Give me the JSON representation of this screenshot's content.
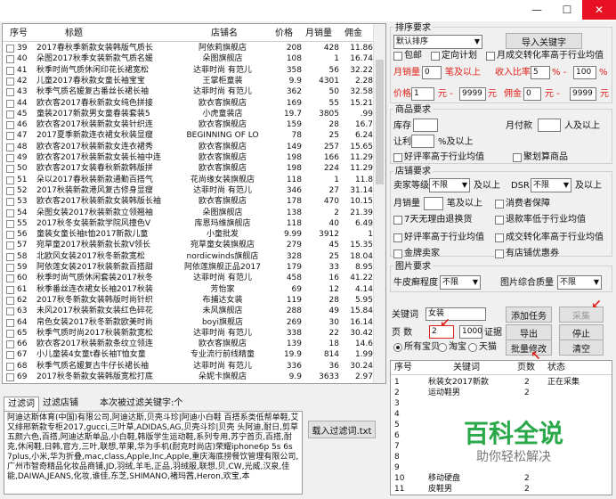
{
  "window": {
    "min": "—",
    "max": "☐",
    "close": "✕"
  },
  "grid": {
    "headers": [
      "序号",
      "标题",
      "店铺名",
      "价格",
      "月销量",
      "佣金"
    ],
    "rows": [
      [
        "39",
        "2017春秋季新款女装韩版气质长",
        "阿依莉旗舰店",
        "208",
        "428",
        "11.86"
      ],
      [
        "40",
        "朵图2017秋季女装新款气质名媛",
        "朵图旗舰店",
        "108",
        "1",
        "16.74"
      ],
      [
        "41",
        "秋季时尚气质休闲印花长裙宽松",
        "达菲时尚 有范儿",
        "358",
        "56",
        "32.22"
      ],
      [
        "42",
        "儿童2017春秋款女童长袖宝宝",
        "王掌柜童装",
        "9.9",
        "4301",
        "2.28"
      ],
      [
        "43",
        "秋季气质名媛复古番丝长裙长袖",
        "达菲时尚 有范儿",
        "362",
        "50",
        "32.58"
      ],
      [
        "44",
        "欧衣客2017春秋新款女纯色拼接",
        "欧衣客旗舰店",
        "169",
        "55",
        "15.21"
      ],
      [
        "45",
        "童装2017新款男女童春装套装5",
        "小虎童装店",
        "19.7",
        "3805",
        ".99"
      ],
      [
        "46",
        "欧衣客2017秋装新款女装针织连",
        "欧衣客旗舰店",
        "159",
        "28",
        "16.7"
      ],
      [
        "47",
        "2017夏季新款连衣裙女秋装显瘦",
        "BEGINNING OF LO",
        "78",
        "25",
        "6.24"
      ],
      [
        "48",
        "欧衣客2017秋装新款女连衣裙秀",
        "欧衣客旗舰店",
        "149",
        "257",
        "15.65"
      ],
      [
        "49",
        "欧衣客2017秋装新款女装长袖中连",
        "欧衣客旗舰店",
        "198",
        "166",
        "11.29"
      ],
      [
        "50",
        "欧衣客2017女装春秋新款韩版拼",
        "欧衣客旗舰店",
        "198",
        "224",
        "11.29"
      ],
      [
        "51",
        "朵以2017春秋装新款通勤百搭气",
        "花尚缘女装旗舰店",
        "118",
        "1",
        "11.8"
      ],
      [
        "52",
        "2017秋装新款港风复古修身显瘦",
        "达菲时尚 有范儿",
        "346",
        "27",
        "31.14"
      ],
      [
        "53",
        "欧衣客2017秋装新款女装韩版长袖",
        "欧衣客旗舰店",
        "178",
        "470",
        "10.15"
      ],
      [
        "54",
        "朵图女装2017秋装新款立领翘袖",
        "朵图旗舰店",
        "138",
        "2",
        "21.39"
      ],
      [
        "55",
        "2017秋冬女装新款学院风撞色V",
        "库恩玛维旗舰店",
        "118",
        "40",
        "6.49"
      ],
      [
        "56",
        "童装女童长袖t恤2017新款儿童",
        "小童批发",
        "9.99",
        "3912",
        "1"
      ],
      [
        "57",
        "宛草童2017秋装新款长款V领长",
        "宛草童女装旗舰店",
        "279",
        "45",
        "15.35"
      ],
      [
        "58",
        "北欧风女装2017秋冬新款宽松",
        "nordicwinds旗舰店",
        "328",
        "25",
        "18.04"
      ],
      [
        "59",
        "阿依莲女装2017秋装新款百搭甜",
        "阿依莲旗舰正品2017",
        "179",
        "33",
        "8.95"
      ],
      [
        "60",
        "秋季时尚气质休闲套装2017秋冬",
        "达菲时尚 有范儿",
        "458",
        "16",
        "41.22"
      ],
      [
        "61",
        "秋季番丝连衣裙女长袖2017秋装",
        "芳怡家",
        "69",
        "12",
        "4.14"
      ],
      [
        "62",
        "2017秋冬新款女装韩版时尚针织",
        "布捕达女装",
        "119",
        "28",
        "5.95"
      ],
      [
        "63",
        "未风2017秋装新款女装红色碎花",
        "未风旗舰店",
        "288",
        "49",
        "15.84"
      ],
      [
        "64",
        "帛色女装2017秋冬新款欧美时尚",
        "boyi旗舰店",
        "269",
        "30",
        "16.14"
      ],
      [
        "65",
        "秋季气质时尚2017秋装新款宽松",
        "达菲时尚 有范儿",
        "338",
        "22",
        "30.42"
      ],
      [
        "66",
        "欧衣客2017秋装新款条纹立领连",
        "欧衣客旗舰店",
        "139",
        "18",
        "14.6"
      ],
      [
        "67",
        "小儿童装4女童t春长袖T恤女童",
        "专业流行前线精童",
        "19.9",
        "814",
        "1.99"
      ],
      [
        "68",
        "秋季气质名媛复古牛仔长裙长袖",
        "达菲时尚 有范儿",
        "336",
        "36",
        "30.24"
      ],
      [
        "69",
        "2017秋冬新款女装韩版宽松打底",
        "朵妮卡旗舰店",
        "9.9",
        "3633",
        "2.97"
      ]
    ]
  },
  "filter": {
    "tab_filter": "过滤词",
    "tab_shop": "过滤店铺",
    "count_label": "本次被过滤关键字:个",
    "text": "阿迪达斯体育(中国)有限公司,阿迪达斯,贝壳斗珍|阿迪小白鞋 百搭系类低帮单鞋,艾又绯邢新款专柜2017,gucci,三叶草,ADIDAS,AG,贝壳斗珍|贝壳 头阿迪,耐日,剪草五颜六色,百搭,阿迪达斯单品,小白鞋,韩版学生运动鞋,系列专用,苏宁首页,百搭,耐克,休闲鞋,日韩,官方,三叶,联想,苹果,华为手机(耐克时尚店)荣耀iphone6p 5s 6s 7plus,小米,华为折叠,mac,class,Apple,Inc,Apple,重庆海底捞餐饮管理有限公司,广州市智奇精品化妆品商铺,JD,羽绒,羊毛,正品,羽绒服,联想,贝,CW,光威,汉泉,佳能,DAIWA,JEANS,化妆,谁佳,东芝,SHIMANO,褚玛茜,Heron,欢宝,本",
    "load_btn": "载入过滤词.txt"
  },
  "sort": {
    "group_title": "排序要求",
    "sort_value": "默认排序",
    "import_btn": "导入关键字",
    "baoyou": "包邮",
    "dingxiang": "定向计划",
    "yuecheng": "月成交转化率高于行业均值",
    "month_sales_label": "月销量",
    "month_sales_min": "0",
    "month_sales_to": "笔及以上",
    "ratio_label": "收入比率",
    "ratio_min": "5",
    "ratio_pct1": "% -",
    "ratio_max": "100",
    "ratio_pct2": "%",
    "price_label": "价格",
    "price_min": "1",
    "yuan1": "元 -",
    "price_max": "9999",
    "yuan2": "元",
    "comm_label": "佣金",
    "comm_min": "0",
    "yuan3": "元 -",
    "comm_max": "9999",
    "yuan4": "元"
  },
  "product": {
    "group_title": "商品要求",
    "stock": "库存",
    "month_pay": "月付款",
    "people_above": "人及以上",
    "rank": "让利",
    "rank_above": "%及以上",
    "good_rate": "好评率高于行业均值",
    "ju": "聚划算商品"
  },
  "shop": {
    "group_title": "店铺要求",
    "level_label": "卖家等级",
    "level_value": "不限",
    "level_above": "及以上",
    "dsr_label": "DSR",
    "dsr_value": "不限",
    "dsr_above": "及以上",
    "month_sales": "月销量",
    "month_sales_above": "笔及以上",
    "consumer": "消费者保障",
    "seven_day": "7天无理由退换货",
    "refund": "退款率低于行业均值",
    "good_rate": "好评率高于行业均值",
    "conv": "成交转化率高于行业均值",
    "gold": "金牌卖家",
    "coupon": "有店铺优惠券"
  },
  "image": {
    "group_title": "图片要求",
    "white_label": "牛皮癣程度",
    "white_value": "不限",
    "score_label": "图片综合质量",
    "score_value": "不限"
  },
  "task": {
    "keyword_label": "关键词",
    "keyword_value": "女装",
    "add_btn": "添加任务",
    "collect_btn": "采集",
    "page_label": "页 数",
    "page_value": "2",
    "delay_value": "1000",
    "delay_unit": "证据",
    "export_btn": "导出",
    "all_label": "所有宝贝",
    "taobao_label": "淘宝",
    "tmall_label": "天猫",
    "batch_btn": "批量修改",
    "stop_btn": "停止",
    "clear_btn": "清空",
    "headers": [
      "序号",
      "关键词",
      "页数",
      "状态"
    ],
    "rows": [
      [
        "1",
        "秋装女2017新款",
        "2",
        "正在采集"
      ],
      [
        "2",
        "运动鞋男",
        "2",
        ""
      ],
      [
        "3",
        "",
        "",
        ""
      ],
      [
        "4",
        "",
        "",
        ""
      ],
      [
        "5",
        "",
        "",
        ""
      ],
      [
        "6",
        "",
        "",
        ""
      ],
      [
        "7",
        "",
        "",
        ""
      ],
      [
        "8",
        "",
        "",
        ""
      ],
      [
        "9",
        "",
        "",
        ""
      ],
      [
        "10",
        "移动硬盘",
        "2",
        ""
      ],
      [
        "11",
        "皮鞋男",
        "2",
        ""
      ]
    ]
  },
  "watermark": {
    "title": "百科全说",
    "sub": "助你轻松解决"
  }
}
